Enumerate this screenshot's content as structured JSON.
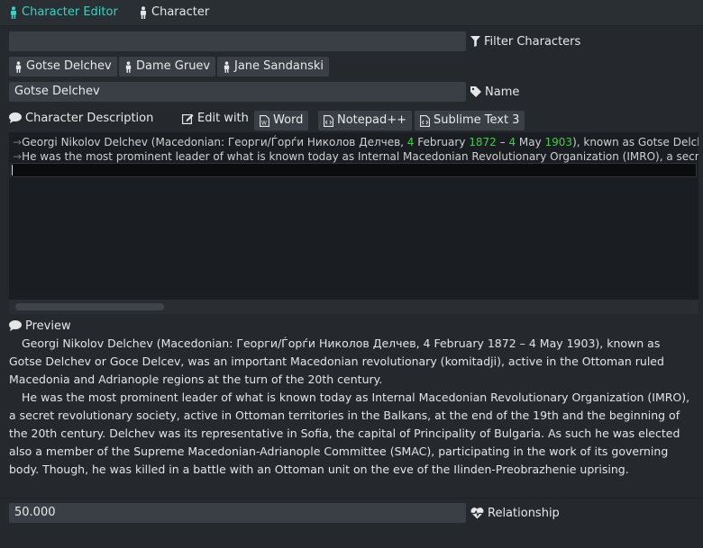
{
  "tabs": [
    {
      "label": "Character Editor",
      "icon": "person-icon",
      "active": true
    },
    {
      "label": "Character",
      "icon": "person-icon",
      "active": false
    }
  ],
  "filter": {
    "value": "",
    "label": "Filter Characters"
  },
  "characters": [
    "Gotse Delchev",
    "Dame Gruev",
    "Jane Sandanski"
  ],
  "name": {
    "value": "Gotse Delchev",
    "label": "Name"
  },
  "description": {
    "label": "Character Description",
    "edit_with": "Edit with",
    "editors": [
      "Word",
      "Notepad++",
      "Sublime Text 3"
    ]
  },
  "editor_lines": {
    "line1": {
      "pre": "Georgi Nikolov Delchev (Macedonian: Георги/Ѓорѓи Николов Делчев, ",
      "n1": "4",
      "mid1": " February ",
      "n2": "1872",
      "mid2": " – ",
      "n3": "4",
      "mid3": " May ",
      "n4": "1903",
      "post": "), known as Gotse Delchev or Goce Delcev, was an important Macedonian revolutionary"
    },
    "line2": "He was the most prominent leader of what is known today as Internal Macedonian Revolutionary Organization (IMRO), a secret revolutionary society"
  },
  "preview": {
    "label": "Preview",
    "paragraphs": [
      "Georgi Nikolov Delchev (Macedonian: Георги/Ѓорѓи Николов Делчев, 4 February 1872 – 4 May 1903), known as Gotse Delchev or Goce Delcev, was an important Macedonian revolutionary (komitadji), active in the Ottoman ruled Macedonia and Adrianople regions at the turn of the 20th century.",
      "He was the most prominent leader of what is known today as Internal Macedonian Revolutionary Organization (IMRO), a secret revolutionary society, active in Ottoman territories in the Balkans, at the end of the 19th and the beginning of the 20th century. Delchev was its representative in Sofia, the capital of Principality of Bulgaria. As such he was elected also a member of the Supreme Macedonian-Adrianople Committee (SMAC), participating in the work of its governing body. Though, he was killed in a battle with an Ottoman unit on the eve of the Ilinden-Preobrazhenie uprising."
    ]
  },
  "relationship": {
    "value": "50.000",
    "label": "Relationship"
  },
  "colors": {
    "accent": "#35d3c3",
    "number": "#3fd13f",
    "background": "#25292e",
    "field": "#3a3f46"
  }
}
